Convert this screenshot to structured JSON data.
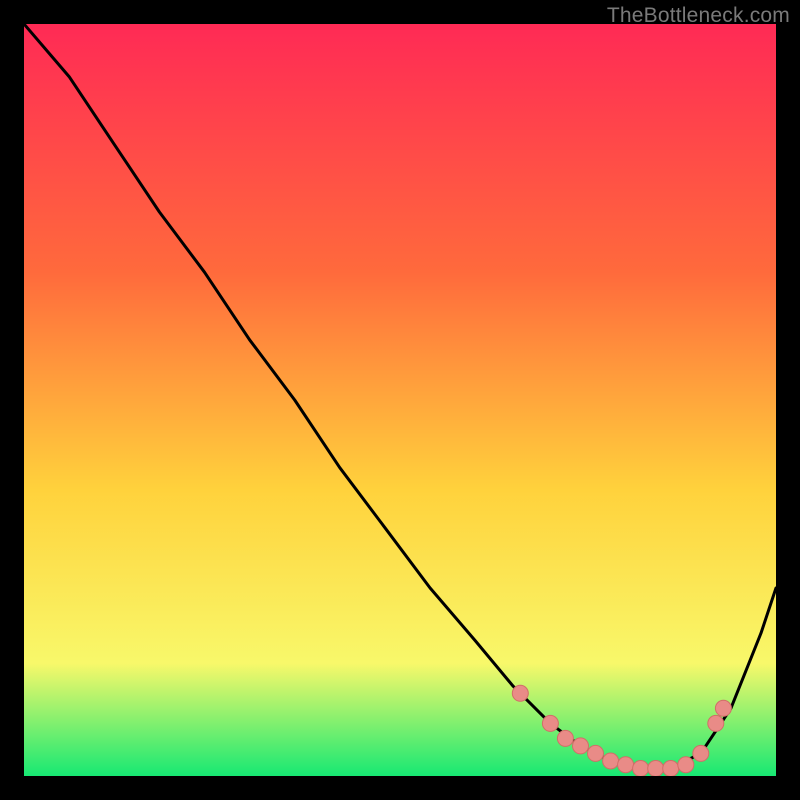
{
  "watermark": "TheBottleneck.com",
  "colors": {
    "bg": "#000000",
    "gradient_top": "#ff2a55",
    "gradient_mid1": "#ff6a3c",
    "gradient_mid2": "#ffd23c",
    "gradient_mid3": "#f8f86a",
    "gradient_bottom": "#17e873",
    "curve": "#000000",
    "marker_fill": "#e98b87",
    "marker_stroke": "#d16e68"
  },
  "chart_data": {
    "type": "line",
    "title": "",
    "xlabel": "",
    "ylabel": "",
    "xlim": [
      0,
      100
    ],
    "ylim": [
      0,
      100
    ],
    "grid": false,
    "legend": false,
    "series": [
      {
        "name": "bottleneck-curve",
        "x": [
          0,
          6,
          12,
          18,
          24,
          30,
          36,
          42,
          48,
          54,
          60,
          65,
          70,
          74,
          78,
          82,
          86,
          90,
          94,
          98,
          100
        ],
        "y": [
          100,
          93,
          84,
          75,
          67,
          58,
          50,
          41,
          33,
          25,
          18,
          12,
          7,
          4,
          2,
          1,
          1,
          3,
          9,
          19,
          25
        ]
      }
    ],
    "markers": {
      "name": "highlighted-band",
      "x": [
        66,
        70,
        72,
        74,
        76,
        78,
        80,
        82,
        84,
        86,
        88,
        90,
        92,
        93
      ],
      "y": [
        11,
        7,
        5,
        4,
        3,
        2,
        1.5,
        1,
        1,
        1,
        1.5,
        3,
        7,
        9
      ]
    }
  }
}
